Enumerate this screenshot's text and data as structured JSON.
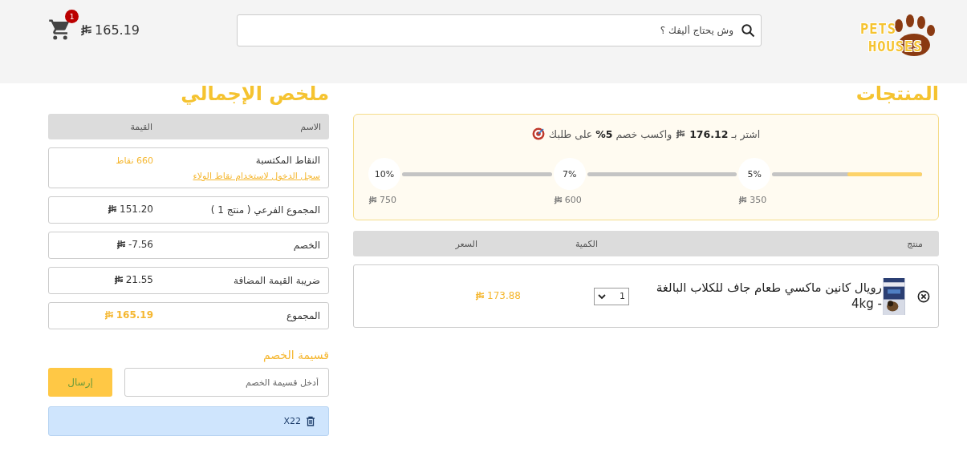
{
  "header": {
    "logo": {
      "line_1": "PETS",
      "line_2": "HOUSES"
    },
    "search": {
      "placeholder": "وش يحتاج أليفك ؟"
    },
    "cart": {
      "badge": "1",
      "total": "165.19"
    }
  },
  "products": {
    "title": "المنتجات",
    "offer": {
      "message_start": "اشتر بـ **176.12**",
      "message_end": "واكسب خصم **5%** على طلبك",
      "milestones": [
        {
          "percent": "5%",
          "amount": "350",
          "level": 0.5
        },
        {
          "percent": "7%",
          "amount": "600"
        },
        {
          "percent": "10%",
          "amount": "750"
        }
      ]
    },
    "columns": [
      "منتج",
      "الكمية",
      "السعر"
    ],
    "items": [
      {
        "name": "رويال كانين ماكسي طعام جاف للكلاب البالغة - 4kg",
        "quantity": "1",
        "price": "173.88"
      }
    ]
  },
  "summary": {
    "title": "ملخص الإجمالي",
    "columns": [
      "الاسم",
      "القيمة"
    ],
    "rows": [
      {
        "kind": "points",
        "label": "النقاط المكتسبة",
        "value": "660 نقاط",
        "link": "سجل الدخول لاستخدام نقاط الولاء"
      },
      {
        "kind": "amount",
        "label": "المجموع الفرعي ( منتج 1 )",
        "value": "151.20"
      },
      {
        "kind": "amount",
        "label": "الخصم",
        "value": "-7.56"
      },
      {
        "kind": "amount",
        "label": "ضريبة القيمة المضافة",
        "value": "21.55"
      },
      {
        "kind": "total",
        "label": "المجموع",
        "value": "165.19"
      }
    ]
  },
  "coupon": {
    "title": "قسيمة الخصم",
    "placeholder": "أدخل قسيمة الخصم",
    "button": "إرسال",
    "applied": "X22"
  }
}
